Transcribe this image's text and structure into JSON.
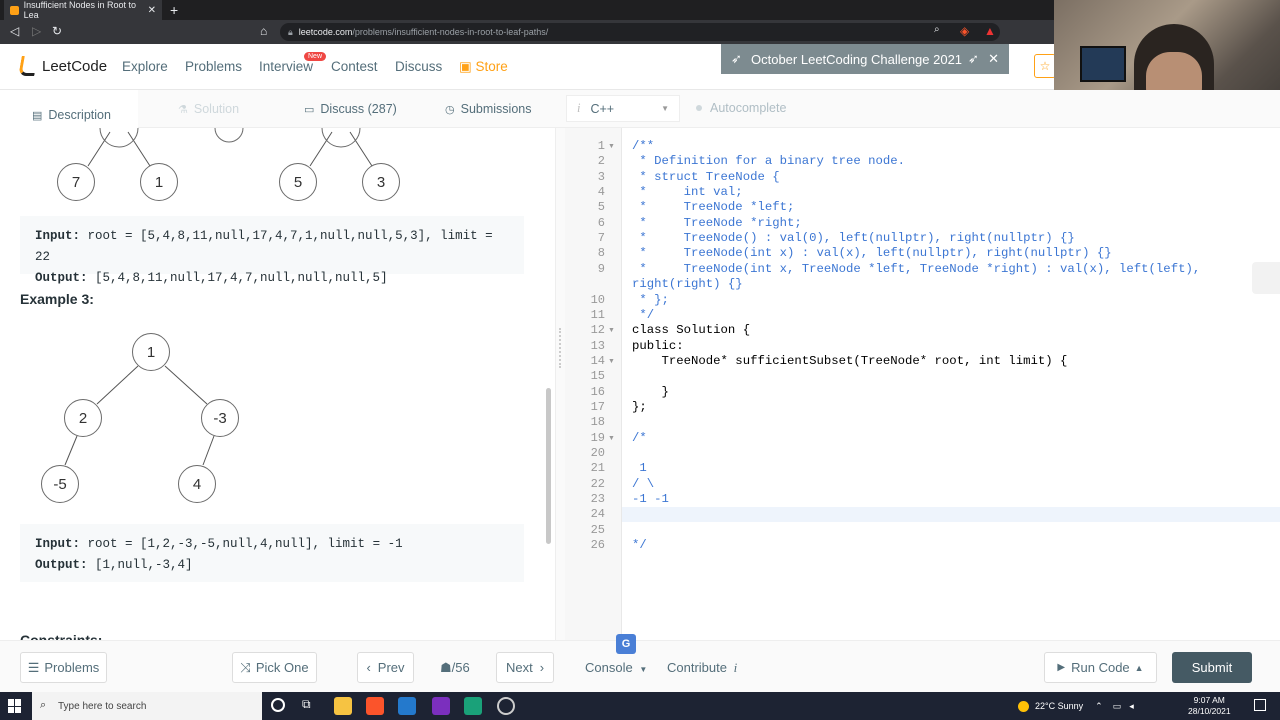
{
  "browser": {
    "tab_title": "Insufficient Nodes in Root to Lea",
    "url_host": "leetcode.com",
    "url_path": "/problems/insufficient-nodes-in-root-to-leaf-paths/"
  },
  "header": {
    "logo_text": "LeetCode",
    "nav": [
      "Explore",
      "Problems",
      "Interview",
      "Contest",
      "Discuss",
      "Store"
    ],
    "new_badge": "New",
    "banner": "October LeetCoding Challenge 2021"
  },
  "left_tabs": {
    "description": "Description",
    "solution": "Solution",
    "discuss": "Discuss (287)",
    "submissions": "Submissions"
  },
  "editor_tabs": {
    "language": "C++",
    "autocomplete": "Autocomplete"
  },
  "example2": {
    "input_label": "Input:",
    "input_value": " root = [5,4,8,11,null,17,4,7,1,null,null,5,3], limit = 22",
    "output_label": "Output:",
    "output_value": " [5,4,8,11,null,17,4,7,null,null,null,5]",
    "tree_nodes": [
      "7",
      "1",
      "5",
      "3"
    ]
  },
  "example3": {
    "title": "Example 3:",
    "tree_nodes": [
      "1",
      "2",
      "-3",
      "-5",
      "4"
    ],
    "input_label": "Input:",
    "input_value": " root = [1,2,-3,-5,null,4,null], limit = -1",
    "output_label": "Output:",
    "output_value": " [1,null,-3,4]"
  },
  "constraints_title": "Constraints:",
  "code_lines": [
    {
      "n": "1",
      "t": "/**",
      "c": "cm",
      "fold": true
    },
    {
      "n": "2",
      "t": " * Definition for a binary tree node.",
      "c": "cm"
    },
    {
      "n": "3",
      "t": " * struct TreeNode {",
      "c": "cm"
    },
    {
      "n": "4",
      "t": " *     int val;",
      "c": "cm"
    },
    {
      "n": "5",
      "t": " *     TreeNode *left;",
      "c": "cm"
    },
    {
      "n": "6",
      "t": " *     TreeNode *right;",
      "c": "cm"
    },
    {
      "n": "7",
      "t": " *     TreeNode() : val(0), left(nullptr), right(nullptr) {}",
      "c": "cm"
    },
    {
      "n": "8",
      "t": " *     TreeNode(int x) : val(x), left(nullptr), right(nullptr) {}",
      "c": "cm"
    },
    {
      "n": "9",
      "t": " *     TreeNode(int x, TreeNode *left, TreeNode *right) : val(x), left(left),",
      "c": "cm"
    },
    {
      "n": "",
      "t": "right(right) {}",
      "c": "cm"
    },
    {
      "n": "10",
      "t": " * };",
      "c": "cm"
    },
    {
      "n": "11",
      "t": " */",
      "c": "cm"
    },
    {
      "n": "12",
      "t": "class Solution {",
      "c": "kw",
      "fold": true
    },
    {
      "n": "13",
      "t": "public:",
      "c": "kw"
    },
    {
      "n": "14",
      "t": "    TreeNode* sufficientSubset(TreeNode* root, int limit) {",
      "c": "kw",
      "fold": true
    },
    {
      "n": "15",
      "t": "",
      "c": "kw"
    },
    {
      "n": "16",
      "t": "    }",
      "c": "kw"
    },
    {
      "n": "17",
      "t": "};",
      "c": "kw"
    },
    {
      "n": "18",
      "t": "",
      "c": "kw"
    },
    {
      "n": "19",
      "t": "/*",
      "c": "cm",
      "fold": true
    },
    {
      "n": "20",
      "t": "",
      "c": "cm"
    },
    {
      "n": "21",
      "t": " 1",
      "c": "cm"
    },
    {
      "n": "22",
      "t": "/ \\",
      "c": "cm"
    },
    {
      "n": "23",
      "t": "-1 -1",
      "c": "cm"
    },
    {
      "n": "24",
      "t": "",
      "c": "cm"
    },
    {
      "n": "25",
      "t": "",
      "c": "cm"
    },
    {
      "n": "26",
      "t": "*/",
      "c": "cm"
    }
  ],
  "footer": {
    "problems": "Problems",
    "pick_one": "Pick One",
    "prev": "Prev",
    "page": "/56",
    "next": "Next",
    "console": "Console",
    "contribute": "Contribute",
    "run_code": "Run Code",
    "submit": "Submit"
  },
  "taskbar": {
    "search_placeholder": "Type here to search",
    "weather": "22°C  Sunny",
    "time": "9:07 AM",
    "date": "28/10/2021"
  }
}
